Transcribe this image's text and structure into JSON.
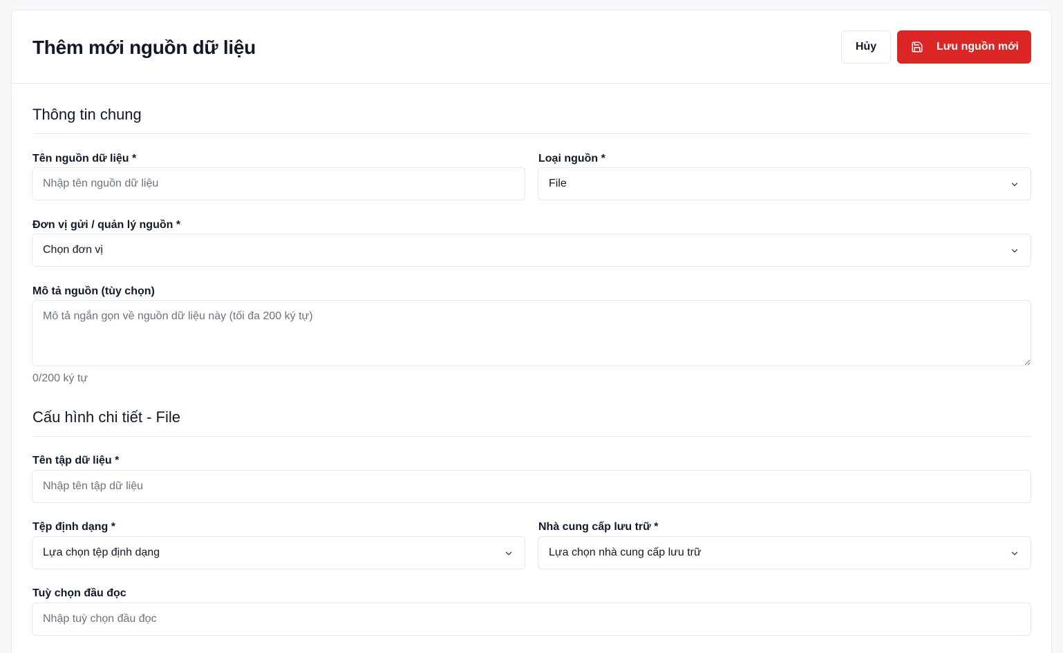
{
  "header": {
    "title": "Thêm mới nguồn dữ liệu",
    "cancel_label": "Hủy",
    "save_label": "Lưu nguồn mới",
    "save_icon": "save-icon",
    "accent_color": "#dc2626"
  },
  "general": {
    "section_title": "Thông tin chung",
    "source_name": {
      "label": "Tên nguồn dữ liệu *",
      "placeholder": "Nhập tên nguồn dữ liệu"
    },
    "source_type": {
      "label": "Loại nguồn *",
      "value": "File"
    },
    "unit": {
      "label": "Đơn vị gửi / quản lý nguồn *",
      "value": "Chọn đơn vị"
    },
    "description": {
      "label": "Mô tả nguồn (tùy chọn)",
      "placeholder": "Mô tả ngắn gọn về nguồn dữ liệu này (tối đa 200 ký tự)",
      "counter": "0/200 ký tự"
    }
  },
  "detail": {
    "section_title": "Cấu hình chi tiết - File",
    "dataset_name": {
      "label": "Tên tập dữ liệu *",
      "placeholder": "Nhập tên tập dữ liệu"
    },
    "file_format": {
      "label": "Tệp định dạng *",
      "value": "Lựa chọn tệp định dạng"
    },
    "storage_provider": {
      "label": "Nhà cung cấp lưu trữ *",
      "value": "Lựa chọn nhà cung cấp lưu trữ"
    },
    "header_option": {
      "label": "Tuỳ chọn đầu đọc",
      "placeholder": "Nhập tuỳ chọn đầu đọc"
    }
  }
}
